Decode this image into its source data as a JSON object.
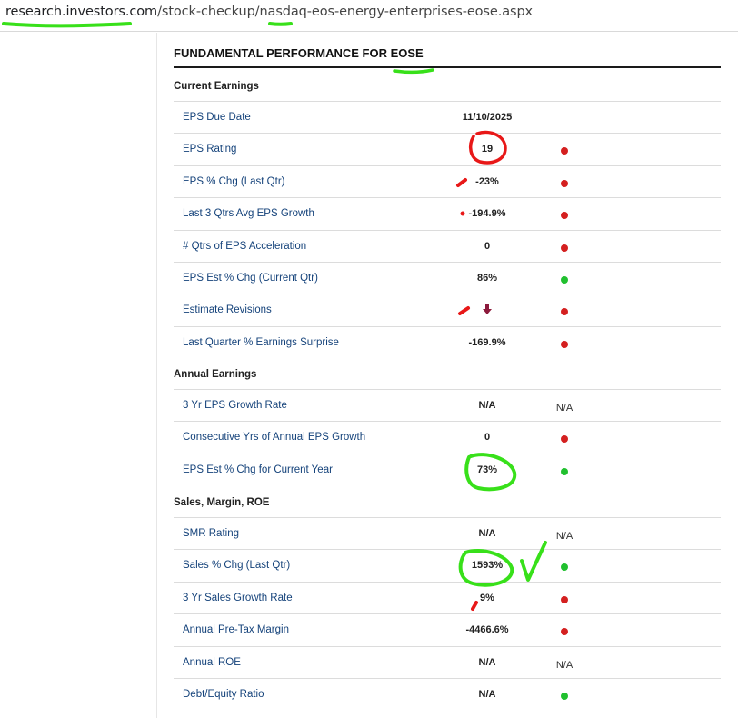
{
  "url": {
    "domain": "research.investors.com",
    "path": "/stock-checkup/nasdaq-eos-energy-enterprises-eose.aspx"
  },
  "panel": {
    "title": "FUNDAMENTAL PERFORMANCE FOR EOSE"
  },
  "colors": {
    "red": "#d42020",
    "green": "#21c02f",
    "link": "#14427a",
    "annotation_green": "#38e01a",
    "annotation_red": "#e81818"
  },
  "sections": [
    {
      "heading": "Current Earnings",
      "rows": [
        {
          "label": "EPS Due Date",
          "value": "11/10/2025",
          "status": "none"
        },
        {
          "label": "EPS Rating",
          "value": "19",
          "status": "red"
        },
        {
          "label": "EPS % Chg (Last Qtr)",
          "value": "-23%",
          "status": "red"
        },
        {
          "label": "Last 3 Qtrs Avg EPS Growth",
          "value": "-194.9%",
          "status": "red"
        },
        {
          "label": "# Qtrs of EPS Acceleration",
          "value": "0",
          "status": "red"
        },
        {
          "label": "EPS Est % Chg (Current Qtr)",
          "value": "86%",
          "status": "green"
        },
        {
          "label": "Estimate Revisions",
          "value": "",
          "icon": "down-arrow-icon",
          "status": "red"
        },
        {
          "label": "Last Quarter % Earnings Surprise",
          "value": "-169.9%",
          "status": "red"
        }
      ]
    },
    {
      "heading": "Annual Earnings",
      "rows": [
        {
          "label": "3 Yr EPS Growth Rate",
          "value": "N/A",
          "status": "text",
          "status_text": "N/A"
        },
        {
          "label": "Consecutive Yrs of Annual EPS Growth",
          "value": "0",
          "status": "red"
        },
        {
          "label": "EPS Est % Chg for Current Year",
          "value": "73%",
          "status": "green"
        }
      ]
    },
    {
      "heading": "Sales, Margin, ROE",
      "rows": [
        {
          "label": "SMR Rating",
          "value": "N/A",
          "status": "text",
          "status_text": "N/A"
        },
        {
          "label": "Sales % Chg (Last Qtr)",
          "value": "1593%",
          "status": "green"
        },
        {
          "label": "3 Yr Sales Growth Rate",
          "value": "9%",
          "status": "red"
        },
        {
          "label": "Annual Pre-Tax Margin",
          "value": "-4466.6%",
          "status": "red"
        },
        {
          "label": "Annual ROE",
          "value": "N/A",
          "status": "text",
          "status_text": "N/A"
        },
        {
          "label": "Debt/Equity Ratio",
          "value": "N/A",
          "status": "green"
        }
      ]
    }
  ]
}
